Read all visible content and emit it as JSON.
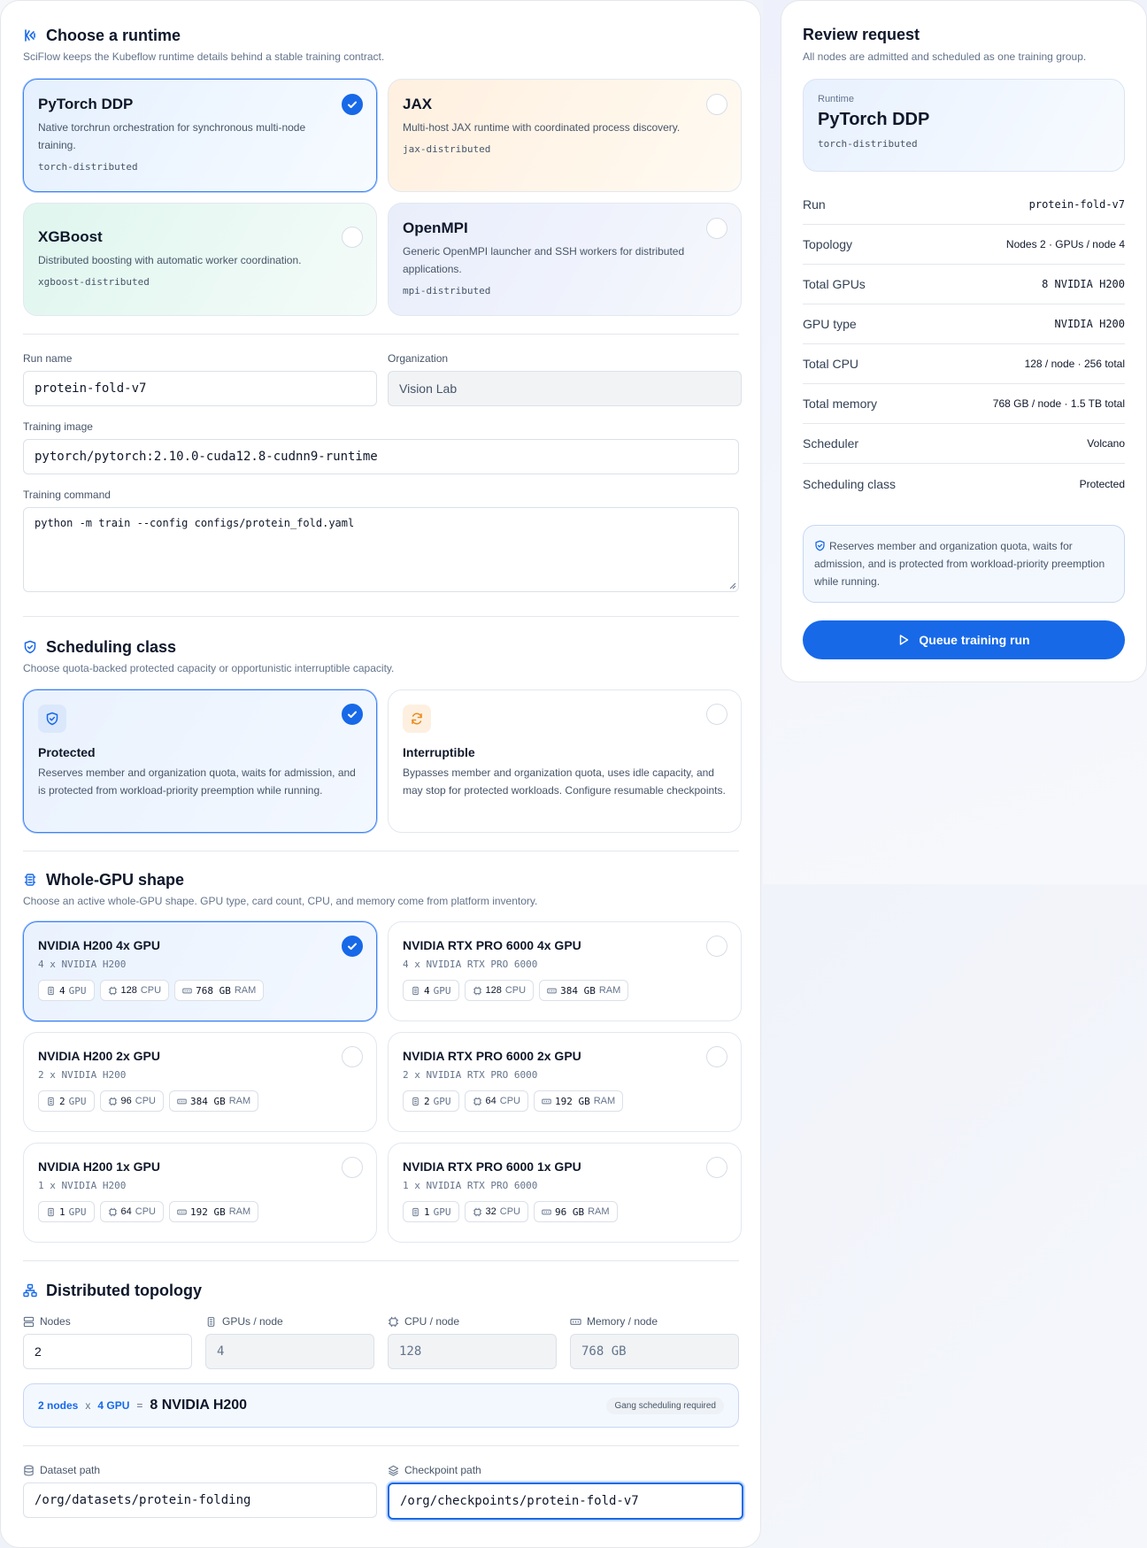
{
  "runtime": {
    "title": "Choose a runtime",
    "subtitle": "SciFlow keeps the Kubeflow runtime details behind a stable training contract.",
    "options": [
      {
        "name": "PyTorch DDP",
        "description": "Native torchrun orchestration for synchronous multi-node training.",
        "code": "torch-distributed",
        "selected": true
      },
      {
        "name": "JAX",
        "description": "Multi-host JAX runtime with coordinated process discovery.",
        "code": "jax-distributed",
        "selected": false
      },
      {
        "name": "XGBoost",
        "description": "Distributed boosting with automatic worker coordination.",
        "code": "xgboost-distributed",
        "selected": false
      },
      {
        "name": "OpenMPI",
        "description": "Generic OpenMPI launcher and SSH workers for distributed applications.",
        "code": "mpi-distributed",
        "selected": false
      }
    ]
  },
  "form": {
    "run_name_label": "Run name",
    "run_name_value": "protein-fold-v7",
    "org_label": "Organization",
    "org_value": "Vision Lab",
    "image_label": "Training image",
    "image_value": "pytorch/pytorch:2.10.0-cuda12.8-cudnn9-runtime",
    "command_label": "Training command",
    "command_value": "python -m train --config configs/protein_fold.yaml"
  },
  "scheduling": {
    "title": "Scheduling class",
    "subtitle": "Choose quota-backed protected capacity or opportunistic interruptible capacity.",
    "options": [
      {
        "name": "Protected",
        "description": "Reserves member and organization quota, waits for admission, and is protected from workload-priority preemption while running.",
        "selected": true
      },
      {
        "name": "Interruptible",
        "description": "Bypasses member and organization quota, uses idle capacity, and may stop for protected workloads. Configure resumable checkpoints.",
        "selected": false
      }
    ]
  },
  "gpu_shape": {
    "title": "Whole-GPU shape",
    "subtitle": "Choose an active whole-GPU shape. GPU type, card count, CPU, and memory come from platform inventory.",
    "options": [
      {
        "name": "NVIDIA H200 4x GPU",
        "sub": "4 x NVIDIA H200",
        "gpu": "4",
        "gpu_unit": "GPU",
        "cpu": "128",
        "cpu_unit": "CPU",
        "ram": "768 GB",
        "ram_unit": "RAM",
        "selected": true
      },
      {
        "name": "NVIDIA RTX PRO 6000 4x GPU",
        "sub": "4 x NVIDIA RTX PRO 6000",
        "gpu": "4",
        "gpu_unit": "GPU",
        "cpu": "128",
        "cpu_unit": "CPU",
        "ram": "384 GB",
        "ram_unit": "RAM",
        "selected": false
      },
      {
        "name": "NVIDIA H200 2x GPU",
        "sub": "2 x NVIDIA H200",
        "gpu": "2",
        "gpu_unit": "GPU",
        "cpu": "96",
        "cpu_unit": "CPU",
        "ram": "384 GB",
        "ram_unit": "RAM",
        "selected": false
      },
      {
        "name": "NVIDIA RTX PRO 6000 2x GPU",
        "sub": "2 x NVIDIA RTX PRO 6000",
        "gpu": "2",
        "gpu_unit": "GPU",
        "cpu": "64",
        "cpu_unit": "CPU",
        "ram": "192 GB",
        "ram_unit": "RAM",
        "selected": false
      },
      {
        "name": "NVIDIA H200 1x GPU",
        "sub": "1 x NVIDIA H200",
        "gpu": "1",
        "gpu_unit": "GPU",
        "cpu": "64",
        "cpu_unit": "CPU",
        "ram": "192 GB",
        "ram_unit": "RAM",
        "selected": false
      },
      {
        "name": "NVIDIA RTX PRO 6000 1x GPU",
        "sub": "1 x NVIDIA RTX PRO 6000",
        "gpu": "1",
        "gpu_unit": "GPU",
        "cpu": "32",
        "cpu_unit": "CPU",
        "ram": "96 GB",
        "ram_unit": "RAM",
        "selected": false
      }
    ]
  },
  "topology": {
    "title": "Distributed topology",
    "nodes_label": "Nodes",
    "nodes_value": "2",
    "gpus_label": "GPUs / node",
    "gpus_value": "4",
    "cpu_label": "CPU / node",
    "cpu_value": "128",
    "mem_label": "Memory / node",
    "mem_value": "768 GB",
    "summary_nodes": "2 nodes",
    "summary_x": "x",
    "summary_gpu": "4 GPU",
    "summary_eq": "=",
    "summary_total": "8 NVIDIA H200",
    "summary_badge": "Gang scheduling required"
  },
  "paths": {
    "dataset_label": "Dataset path",
    "dataset_value": "/org/datasets/protein-folding",
    "checkpoint_label": "Checkpoint path",
    "checkpoint_value": "/org/checkpoints/protein-fold-v7"
  },
  "review": {
    "title": "Review request",
    "subtitle": "All nodes are admitted and scheduled as one training group.",
    "runtime_label": "Runtime",
    "runtime_name": "PyTorch DDP",
    "runtime_code": "torch-distributed",
    "rows": [
      {
        "k": "Run",
        "v": "protein-fold-v7",
        "mono": true
      },
      {
        "k": "Topology",
        "v": "Nodes 2 · GPUs / node 4",
        "mono": false
      },
      {
        "k": "Total GPUs",
        "v": "8 NVIDIA H200",
        "mono": true
      },
      {
        "k": "GPU type",
        "v": "NVIDIA H200",
        "mono": true
      },
      {
        "k": "Total CPU",
        "v": "128 / node · 256 total",
        "mono": false
      },
      {
        "k": "Total memory",
        "v": "768 GB / node · 1.5 TB total",
        "mono": false
      },
      {
        "k": "Scheduler",
        "v": "Volcano",
        "mono": false
      },
      {
        "k": "Scheduling class",
        "v": "Protected",
        "mono": false
      }
    ],
    "note": "Reserves member and organization quota, waits for admission, and is protected from workload-priority preemption while running.",
    "queue_label": "Queue training run"
  },
  "colors": {
    "accent": "#1769e8",
    "selected_border": "#3b82f6",
    "orange": "#ea8a1a"
  }
}
